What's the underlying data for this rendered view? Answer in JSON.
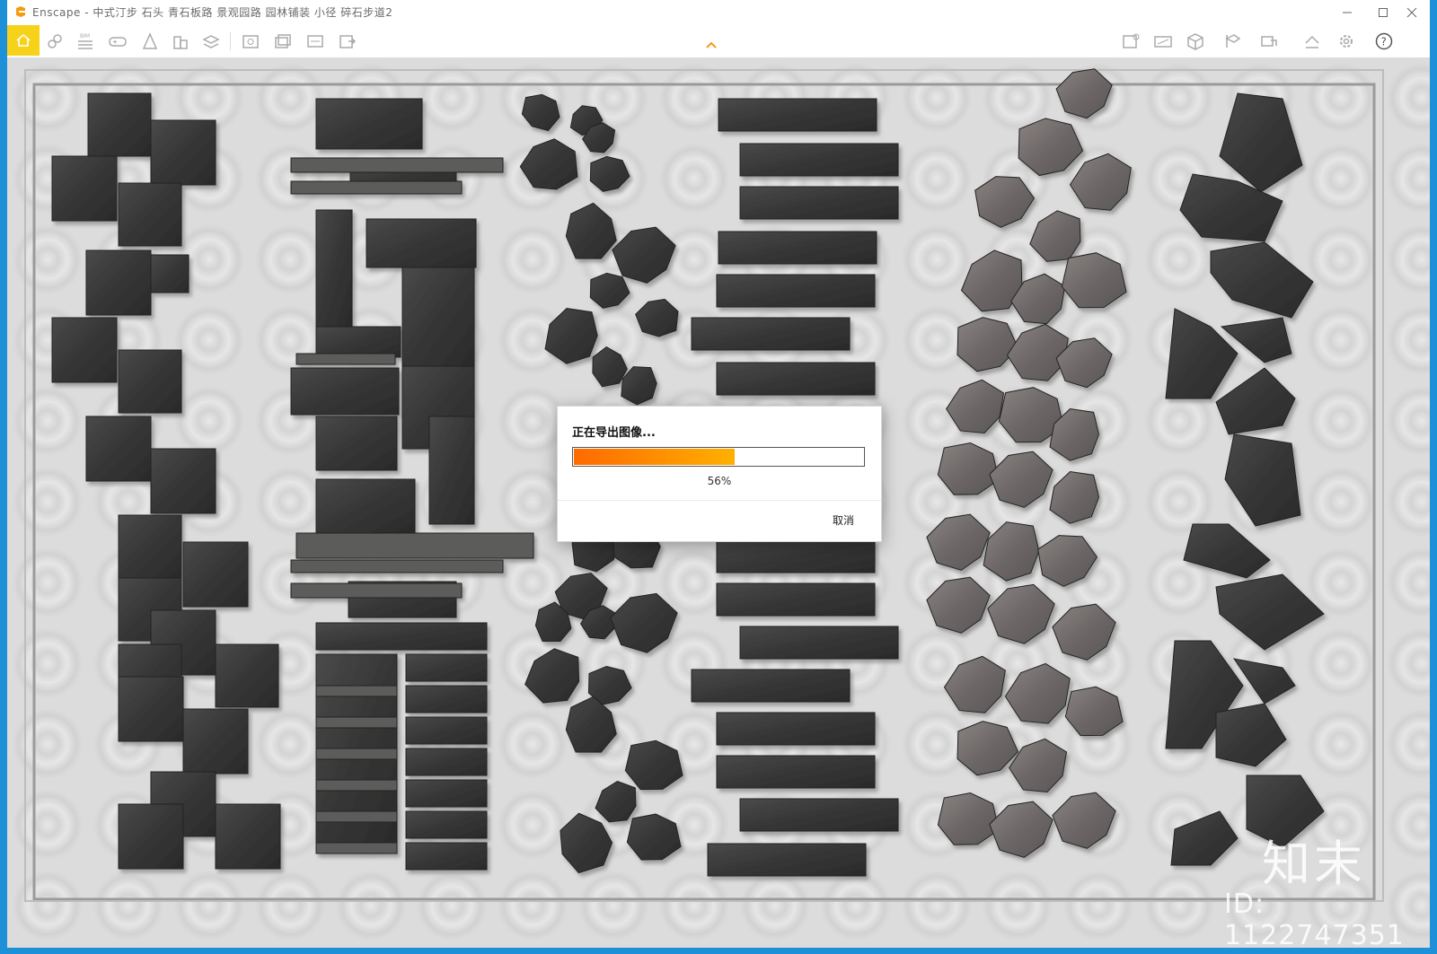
{
  "window": {
    "title": "Enscape - 中式汀步 石头 青石板路 景观园路 园林铺装 小径 碎石步道2",
    "minimize_icon": "minimize-icon",
    "maximize_icon": "maximize-icon",
    "close_icon": "close-icon"
  },
  "toolbar": {
    "left_icons": [
      "home-icon",
      "link-icon",
      "bim-icon",
      "gamepad-icon",
      "asset-icon",
      "building-icon",
      "layers-icon",
      "screenshot-icon",
      "batch-render-icon",
      "360-render-icon",
      "export-icon"
    ],
    "right_icons": [
      "view-management-icon",
      "panorama-icon",
      "package-icon",
      "video-icon",
      "sync-icon",
      "upload-icon",
      "settings-icon",
      "help-icon"
    ],
    "bim_label": "BIM",
    "collapse_icon": "chevron-up-icon"
  },
  "dialog": {
    "title": "正在导出图像...",
    "progress": 0.56,
    "percent_label": "56%",
    "cancel_label": "取消"
  },
  "watermark": {
    "logo_text": "知末",
    "id_text": "ID: 1122747351"
  },
  "colors": {
    "accent": "#f7d21a",
    "progress_start": "#ff6a00",
    "progress_end": "#ffb000",
    "window_border": "#1e90d8"
  }
}
